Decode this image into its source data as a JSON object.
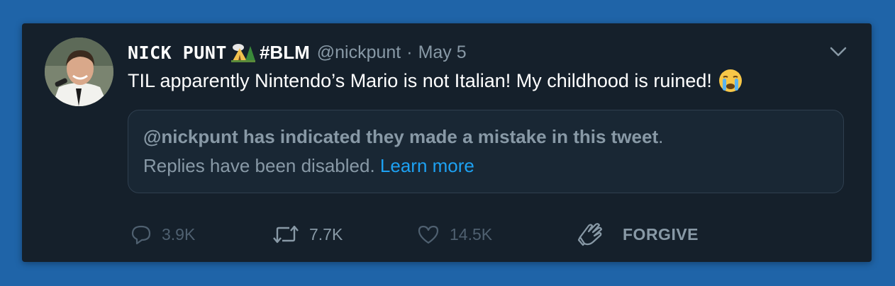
{
  "tweet": {
    "display_name": "NICK PUNT",
    "tag": "#BLM",
    "handle": "@nickpunt",
    "separator": "·",
    "date": "May 5",
    "text": "TIL apparently Nintendo’s Mario is not Italian! My childhood is ruined!",
    "name_emoji_icon": "camping-tent-icon",
    "text_emoji_icon": "crying-face-icon"
  },
  "notice": {
    "bold_text": "@nickpunt has indicated they made a mistake in this tweet",
    "period": ".",
    "replies_text": "Replies have been disabled.",
    "link_text": "Learn more"
  },
  "actions": {
    "replies": "3.9K",
    "retweets": "7.7K",
    "likes": "14.5K",
    "forgive_label": "FORGIVE"
  },
  "colors": {
    "background": "#1f64a8",
    "card": "#15202b",
    "text": "#ffffff",
    "secondary": "#8899a6",
    "link": "#1da1f2"
  }
}
